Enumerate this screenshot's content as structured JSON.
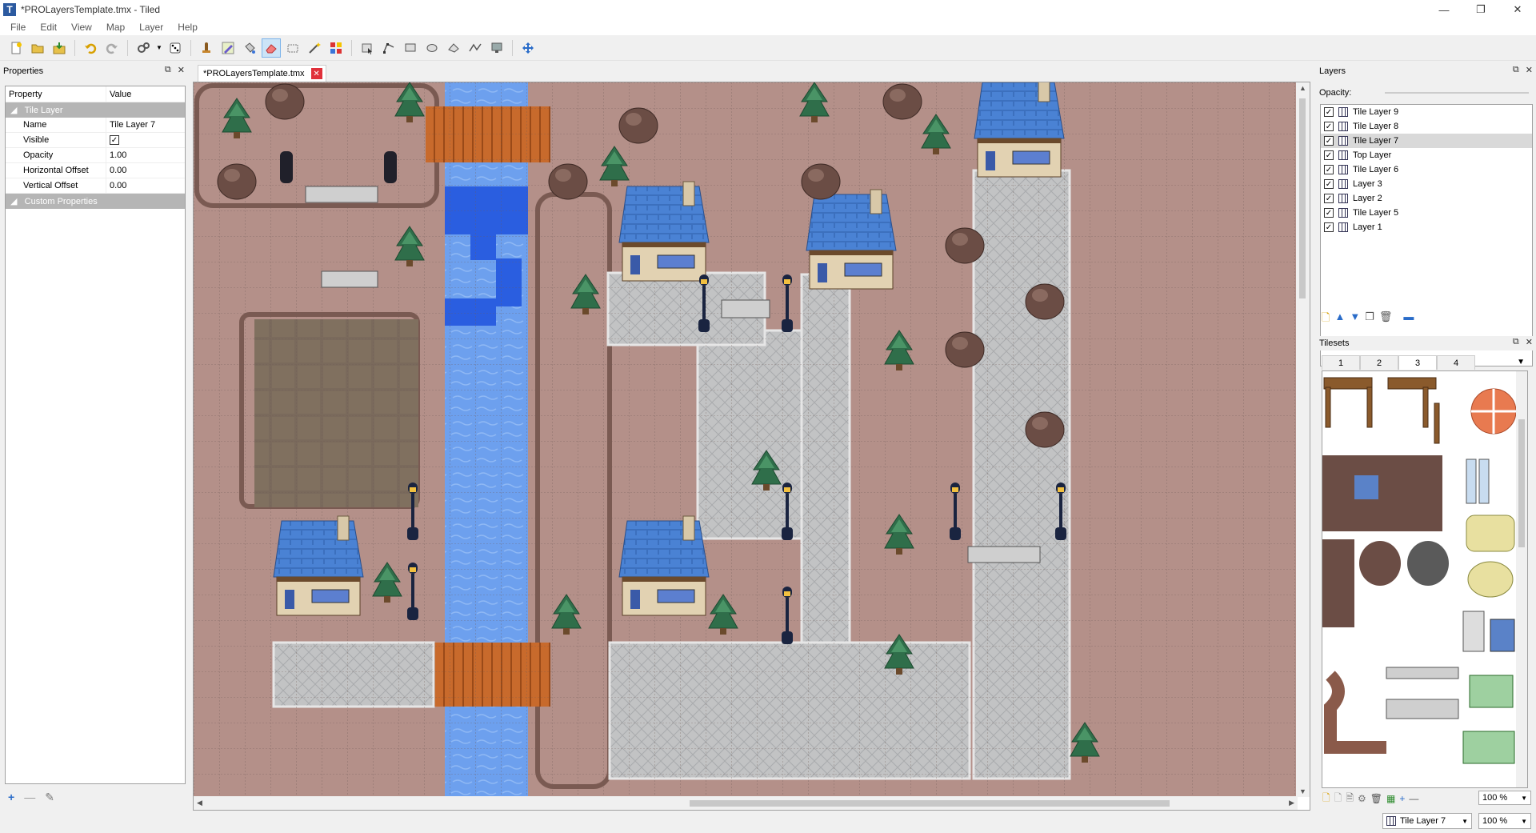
{
  "window": {
    "title": "*PROLayersTemplate.tmx - Tiled",
    "min": "—",
    "max": "❐",
    "close": "✕"
  },
  "menu": [
    "File",
    "Edit",
    "View",
    "Map",
    "Layer",
    "Help"
  ],
  "toolbar": [
    "new-file",
    "open",
    "save",
    "undo",
    "redo",
    "commands",
    "random",
    "stamp-brush",
    "terrain-brush",
    "bucket-fill",
    "eraser",
    "rect-select",
    "magic-wand",
    "select-same",
    "object-select",
    "edit-polygons",
    "insert-rect",
    "insert-ellipse",
    "insert-polygon",
    "insert-polyline",
    "insert-tile",
    "move"
  ],
  "properties": {
    "title": "Properties",
    "col_property": "Property",
    "col_value": "Value",
    "group_tile_layer": "Tile Layer",
    "rows": [
      {
        "name": "Name",
        "value": "Tile Layer 7"
      },
      {
        "name": "Visible",
        "value": ""
      },
      {
        "name": "Opacity",
        "value": "1.00"
      },
      {
        "name": "Horizontal Offset",
        "value": "0.00"
      },
      {
        "name": "Vertical Offset",
        "value": "0.00"
      }
    ],
    "group_custom": "Custom Properties"
  },
  "document": {
    "tab_label": "*PROLayersTemplate.tmx"
  },
  "layers": {
    "title": "Layers",
    "opacity_label": "Opacity:",
    "opacity": 1.0,
    "items": [
      "Tile Layer 9",
      "Tile Layer 8",
      "Tile Layer 7",
      "Top Layer",
      "Tile Layer 6",
      "Layer 3",
      "Layer 2",
      "Tile Layer 5",
      "Layer 1"
    ],
    "selected": "Tile Layer 7"
  },
  "tilesets": {
    "title": "Tilesets",
    "tabs": [
      "1",
      "2",
      "3",
      "4"
    ],
    "selected_tab": "3",
    "zoom": "100 %"
  },
  "status": {
    "current_layer": "Tile Layer 7",
    "zoom": "100 %"
  },
  "colors": {
    "accent": "#0078d7",
    "water": "#3a74d8",
    "dirt": "#b08e83",
    "path": "#bfc0c0",
    "roof": "#4a7fcf"
  }
}
